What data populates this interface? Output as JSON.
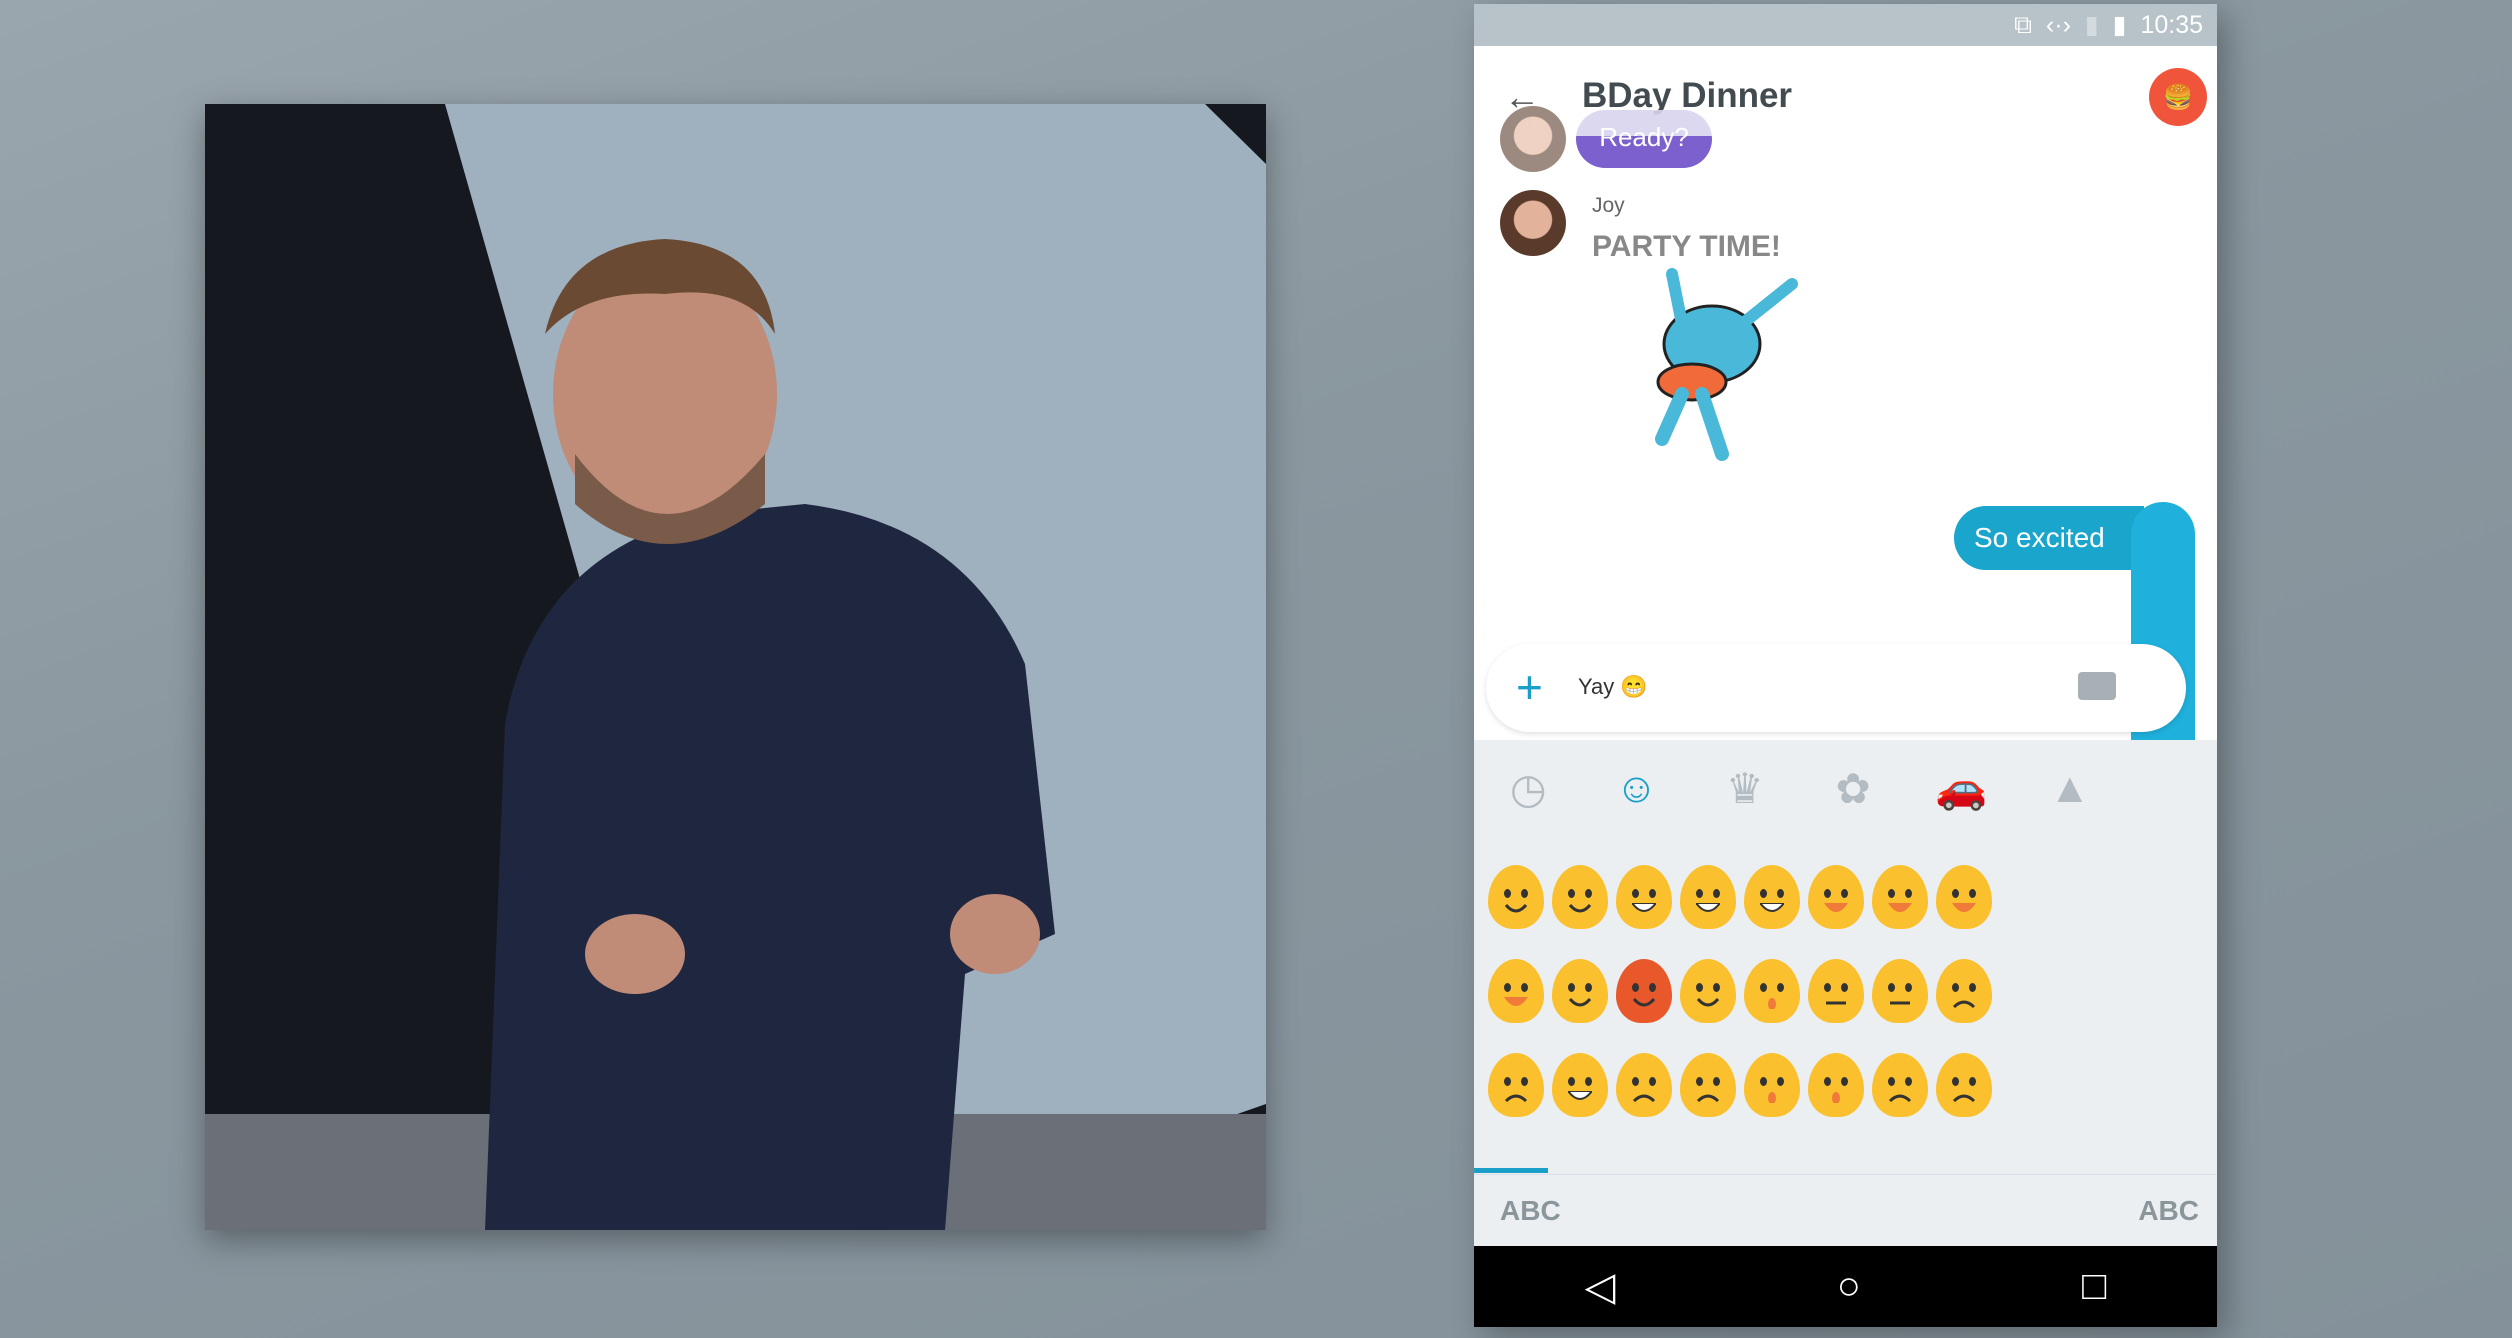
{
  "status_bar": {
    "time": "10:35",
    "icons": [
      "cast-icon",
      "data-sync-icon",
      "no-sim-icon",
      "battery-icon"
    ]
  },
  "header": {
    "title": "BDay Dinner",
    "back_icon": "arrow-left-icon",
    "group_avatar_icon": "burger-icon"
  },
  "messages": [
    {
      "type": "incoming",
      "text": "Ready?",
      "color": "#6e4fc8"
    },
    {
      "type": "incoming-sticker",
      "sender": "Joy",
      "sticker_text": "PARTY TIME!"
    },
    {
      "type": "outgoing",
      "text": "So excited",
      "color": "#1aa6cc"
    }
  ],
  "compose": {
    "value": "Yay 😁",
    "add_icon": "plus-icon",
    "keyboard_icon": "keyboard-icon",
    "send_icon": "send-icon"
  },
  "emoji_keyboard": {
    "categories": [
      {
        "name": "recent",
        "icon": "clock-icon",
        "glyph": "◷"
      },
      {
        "name": "smileys",
        "icon": "smiley-icon",
        "glyph": "☺",
        "active": true
      },
      {
        "name": "objects",
        "icon": "crown-icon",
        "glyph": "♛"
      },
      {
        "name": "nature",
        "icon": "flower-icon",
        "glyph": "✿"
      },
      {
        "name": "places",
        "icon": "car-icon",
        "glyph": "🚗"
      },
      {
        "name": "symbols",
        "icon": "triangle-icon",
        "glyph": "▲"
      }
    ],
    "emojis": [
      {
        "name": "smile",
        "mouth": "smile"
      },
      {
        "name": "blush",
        "mouth": "smile"
      },
      {
        "name": "grin",
        "mouth": "grin"
      },
      {
        "name": "grin-squint",
        "mouth": "grin"
      },
      {
        "name": "joy",
        "mouth": "grin"
      },
      {
        "name": "smiley",
        "mouth": "open"
      },
      {
        "name": "smile-open",
        "mouth": "open"
      },
      {
        "name": "sweat-smile",
        "mouth": "open"
      },
      {
        "name": "laughing",
        "mouth": "open"
      },
      {
        "name": "innocent",
        "mouth": "smile"
      },
      {
        "name": "smiling-imp",
        "mouth": "smile",
        "devil": true
      },
      {
        "name": "wink",
        "mouth": "smile"
      },
      {
        "name": "hushed",
        "mouth": "o"
      },
      {
        "name": "neutral",
        "mouth": "flat"
      },
      {
        "name": "expressionless",
        "mouth": "flat"
      },
      {
        "name": "worried",
        "mouth": "frown"
      },
      {
        "name": "angry",
        "mouth": "frown"
      },
      {
        "name": "grimacing",
        "mouth": "grin"
      },
      {
        "name": "pouting",
        "mouth": "frown"
      },
      {
        "name": "disappointed-relieved",
        "mouth": "frown"
      },
      {
        "name": "sleepy",
        "mouth": "o"
      },
      {
        "name": "open-mouth",
        "mouth": "o"
      },
      {
        "name": "persevere",
        "mouth": "frown"
      },
      {
        "name": "triumph",
        "mouth": "frown"
      }
    ],
    "abc_left": "ABC",
    "abc_right": "ABC"
  },
  "nav_bar": {
    "back": "◁",
    "home": "○",
    "recents": "□"
  }
}
